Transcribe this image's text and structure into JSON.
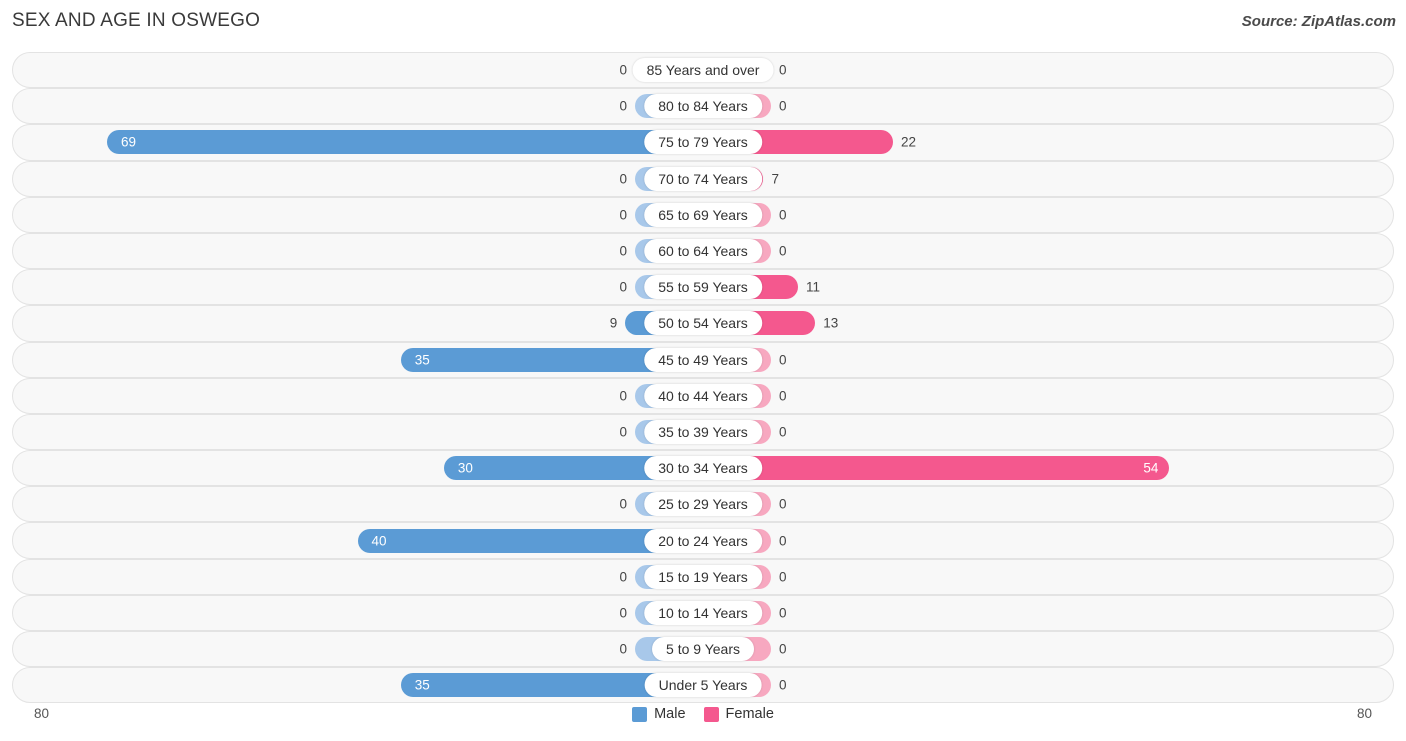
{
  "header": {
    "title": "SEX AND AGE IN OSWEGO",
    "source": "Source: ZipAtlas.com"
  },
  "axis": {
    "left_label": "80",
    "right_label": "80"
  },
  "legend": {
    "male_label": "Male",
    "female_label": "Female"
  },
  "colors": {
    "male": "#5b9bd5",
    "male_zero": "#a8c8ea",
    "female": "#f4588e",
    "female_zero": "#f7a8c0",
    "row_background": "#f8f8f8",
    "row_border": "#e3e3e3"
  },
  "chart_data": {
    "type": "bar",
    "title": "SEX AND AGE IN OSWEGO",
    "subtitle": "Source: ZipAtlas.com",
    "orientation": "horizontal",
    "style": "population-pyramid",
    "xlabel": "",
    "ylabel": "",
    "xlim": [
      0,
      80
    ],
    "axis_max": 80,
    "grid": false,
    "legend_position": "bottom",
    "categories": [
      "85 Years and over",
      "80 to 84 Years",
      "75 to 79 Years",
      "70 to 74 Years",
      "65 to 69 Years",
      "60 to 64 Years",
      "55 to 59 Years",
      "50 to 54 Years",
      "45 to 49 Years",
      "40 to 44 Years",
      "35 to 39 Years",
      "30 to 34 Years",
      "25 to 29 Years",
      "20 to 24 Years",
      "15 to 19 Years",
      "10 to 14 Years",
      "5 to 9 Years",
      "Under 5 Years"
    ],
    "series": [
      {
        "name": "Male",
        "color": "#5b9bd5",
        "values": [
          0,
          0,
          69,
          0,
          0,
          0,
          0,
          9,
          35,
          0,
          0,
          30,
          0,
          40,
          0,
          0,
          0,
          35
        ]
      },
      {
        "name": "Female",
        "color": "#f4588e",
        "values": [
          0,
          0,
          22,
          7,
          0,
          0,
          11,
          13,
          0,
          0,
          0,
          54,
          0,
          0,
          0,
          0,
          0,
          0
        ]
      }
    ]
  }
}
